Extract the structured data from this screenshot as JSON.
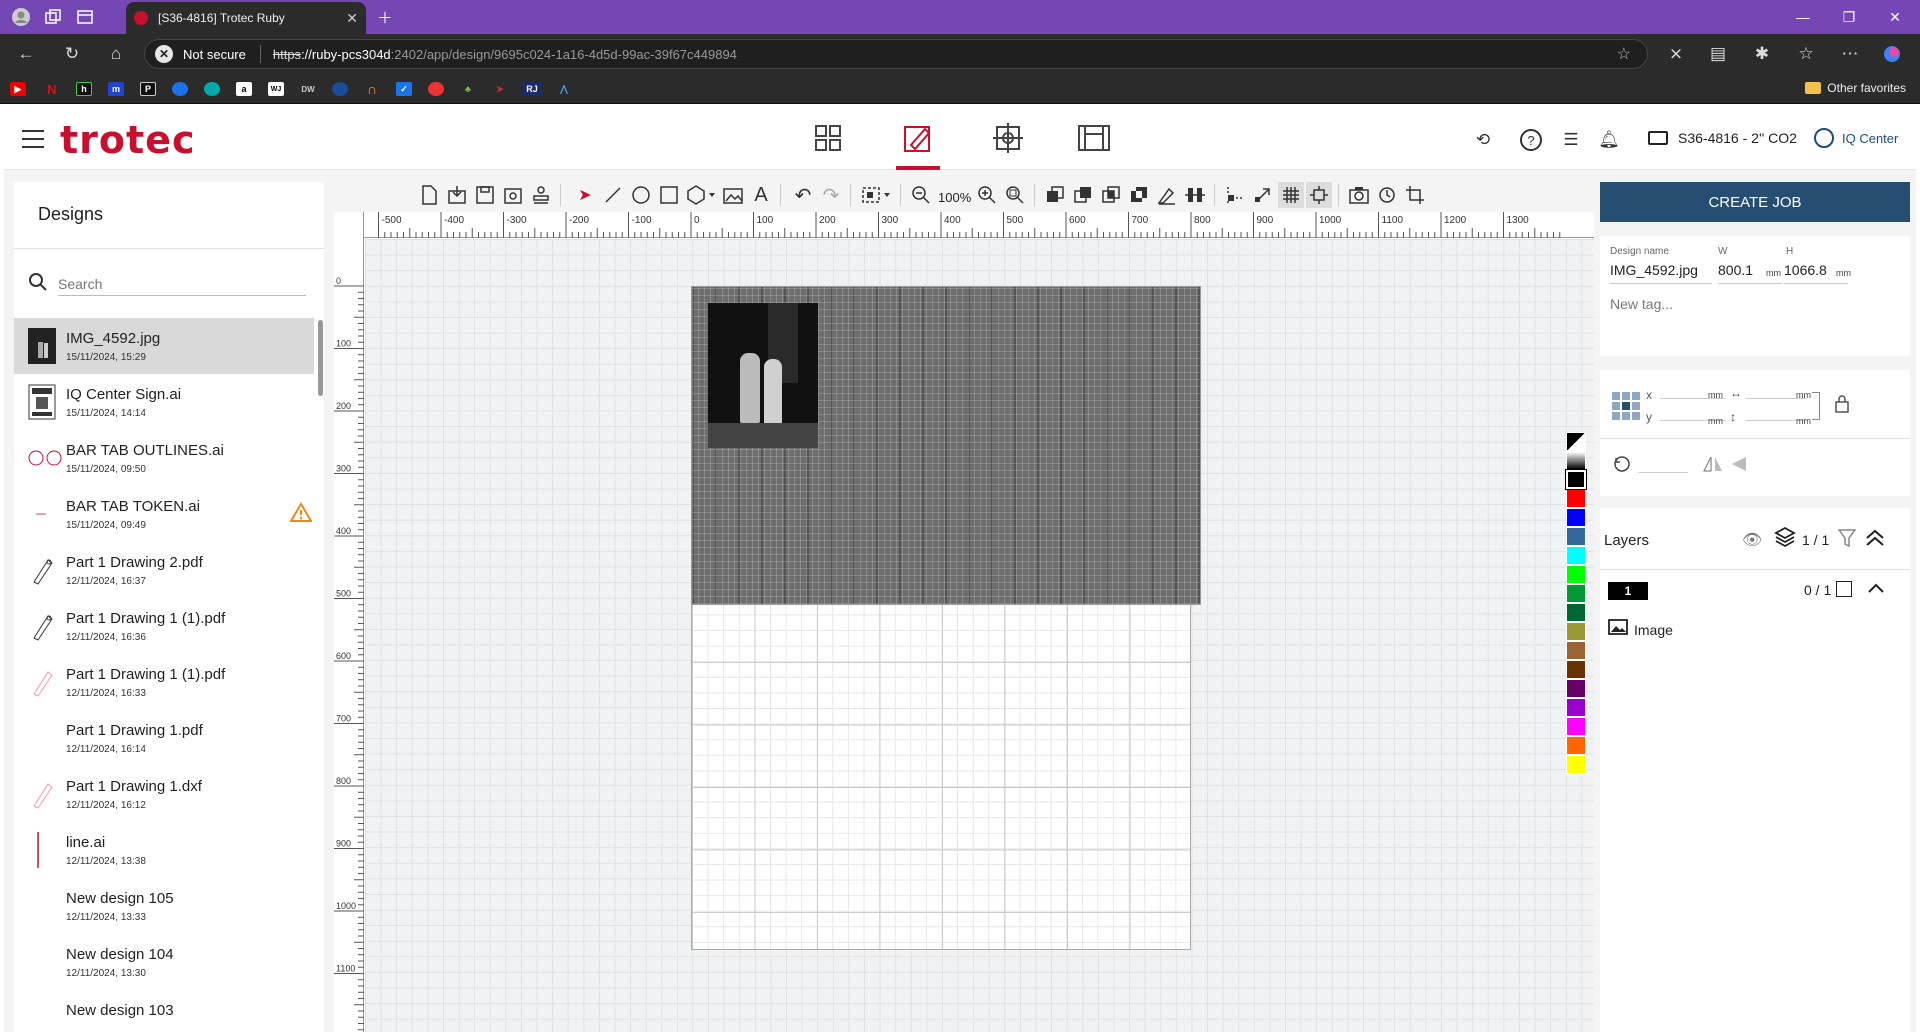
{
  "browser": {
    "tab_title": "[S36-4816] Trotec Ruby",
    "not_secure": "Not secure",
    "url_scheme": "https",
    "url_host": "://ruby-pcs304d",
    "url_path": ":2402/app/design/9695c024-1a16-4d5d-99ac-39f67c449894",
    "other_favorites": "Other favorites",
    "bookmarks": [
      "youtube-icon",
      "netflix-icon",
      "h-icon",
      "m-icon",
      "p-icon",
      "cloud-icon",
      "edge-icon",
      "amazon-icon",
      "wsj-icon",
      "dw-icon",
      "weather-icon",
      "headphones-icon",
      "check-icon",
      "pokeball-icon",
      "plant-icon",
      "arrow-icon",
      "rj-icon",
      "ie-icon"
    ]
  },
  "app": {
    "logo": "trotec",
    "machine": "S36-4816 - 2'' CO2",
    "user": "IQ Center",
    "accent": "#c8102e",
    "create_job_color": "#264e72"
  },
  "designs": {
    "title": "Designs",
    "search_placeholder": "Search",
    "items": [
      {
        "name": "IMG_4592.jpg",
        "date": "15/11/2024, 15:29",
        "selected": true,
        "thumb": "photo"
      },
      {
        "name": "IQ Center Sign.ai",
        "date": "15/11/2024, 14:14",
        "thumb": "sign"
      },
      {
        "name": "BAR TAB OUTLINES.ai",
        "date": "15/11/2024, 09:50",
        "thumb": "tokens"
      },
      {
        "name": "BAR TAB TOKEN.ai",
        "date": "15/11/2024, 09:49",
        "thumb": "dash",
        "warning": true
      },
      {
        "name": "Part 1 Drawing 2.pdf",
        "date": "12/11/2024, 16:37",
        "thumb": "part"
      },
      {
        "name": "Part 1 Drawing 1 (1).pdf",
        "date": "12/11/2024, 16:36",
        "thumb": "part"
      },
      {
        "name": "Part 1 Drawing 1 (1).pdf",
        "date": "12/11/2024, 16:33",
        "thumb": "part-red"
      },
      {
        "name": "Part 1 Drawing 1.pdf",
        "date": "12/11/2024, 16:14",
        "thumb": "none"
      },
      {
        "name": "Part 1 Drawing 1.dxf",
        "date": "12/11/2024, 16:12",
        "thumb": "part-red"
      },
      {
        "name": "line.ai",
        "date": "12/11/2024, 13:38",
        "thumb": "line"
      },
      {
        "name": "New design 105",
        "date": "12/11/2024, 13:33",
        "thumb": "none"
      },
      {
        "name": "New design 104",
        "date": "12/11/2024, 13:30",
        "thumb": "none"
      },
      {
        "name": "New design 103",
        "date": "",
        "thumb": "none"
      }
    ]
  },
  "toolbar": {
    "zoom": "100%"
  },
  "rulers": {
    "top": [
      "-500",
      "-400",
      "-300",
      "-200",
      "-100",
      "0",
      "100",
      "200",
      "300",
      "400",
      "500",
      "600",
      "700",
      "800",
      "900",
      "1000",
      "1100",
      "1200",
      "1300"
    ],
    "left": [
      "0",
      "100",
      "200",
      "300",
      "400",
      "500",
      "600",
      "700",
      "800",
      "900",
      "1000",
      "1100"
    ]
  },
  "palette": [
    "#000000",
    "#444444",
    "#000000",
    "#ff0000",
    "#0000ff",
    "#336699",
    "#00ffff",
    "#00ff00",
    "#009933",
    "#006633",
    "#999933",
    "#996633",
    "#663300",
    "#660066",
    "#9900cc",
    "#ff00ff",
    "#ff6600",
    "#ffff00"
  ],
  "properties": {
    "design_name_label": "Design name",
    "design_name": "IMG_4592.jpg",
    "w_label": "W",
    "w_value": "800.1",
    "h_label": "H",
    "h_value": "1066.8",
    "unit": "mm",
    "new_tag": "New tag...",
    "x_label": "x",
    "y_label": "y"
  },
  "layers": {
    "title": "Layers",
    "count": "1 / 1",
    "layer_number": "1",
    "layer_count": "0 / 1",
    "item_label": "Image"
  }
}
